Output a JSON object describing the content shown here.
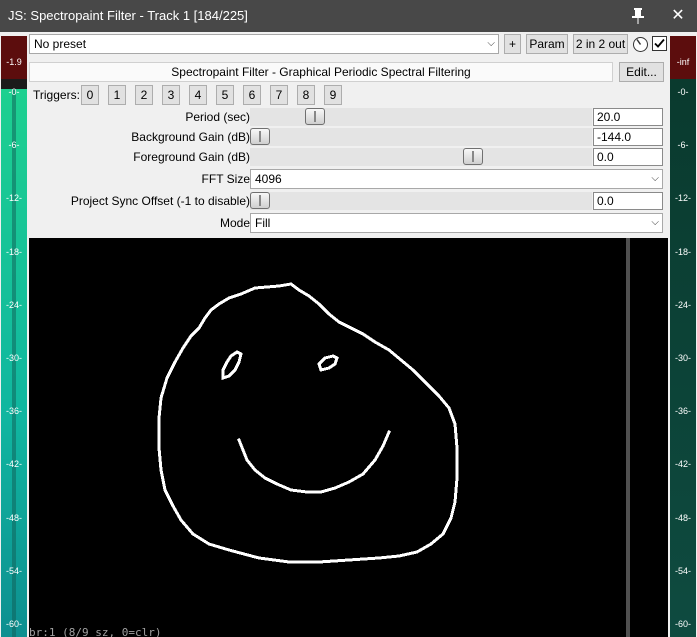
{
  "window": {
    "title": "JS: Spectropaint Filter - Track 1 [184/225]",
    "close_glyph": "✕"
  },
  "meters": {
    "left": {
      "peak": "-1.9",
      "ticks": [
        "-0-",
        "-6-",
        "-12-",
        "-18-",
        "-24-",
        "-30-",
        "-36-",
        "-42-",
        "-48-",
        "-54-",
        "-60-"
      ]
    },
    "right": {
      "peak": "-inf",
      "ticks": [
        "-0-",
        "-6-",
        "-12-",
        "-18-",
        "-24-",
        "-30-",
        "-36-",
        "-42-",
        "-48-",
        "-54-",
        "-60-"
      ]
    }
  },
  "toolbar": {
    "preset": "No preset",
    "plus_label": "+",
    "param_label": "Param",
    "io_label": "2 in 2 out",
    "enabled": true,
    "edit_label": "Edit..."
  },
  "description": "Spectropaint Filter - Graphical Periodic Spectral Filtering",
  "triggers": {
    "label": "Triggers:",
    "buttons": [
      "0",
      "1",
      "2",
      "3",
      "4",
      "5",
      "6",
      "7",
      "8",
      "9"
    ]
  },
  "params": {
    "period": {
      "label": "Period (sec)",
      "value": "20.0",
      "position": 0.17
    },
    "bg_gain": {
      "label": "Background Gain (dB)",
      "value": "-144.0",
      "position": 0.0
    },
    "fg_gain": {
      "label": "Foreground Gain (dB)",
      "value": "0.0",
      "position": 0.66
    },
    "fft_size": {
      "label": "FFT Size",
      "value": "4096"
    },
    "sync_offset": {
      "label": "Project Sync Offset (-1 to disable)",
      "value": "0.0",
      "position": 0.0
    },
    "mode": {
      "label": "Mode",
      "value": "Fill"
    }
  },
  "canvas": {
    "status": "br:1 (8/9 sz, 0=clr)"
  },
  "colors": {
    "titlebar": "#484848",
    "canvas": "#000000",
    "drawing": "#ffffff",
    "meter_green": "#1dd090"
  }
}
